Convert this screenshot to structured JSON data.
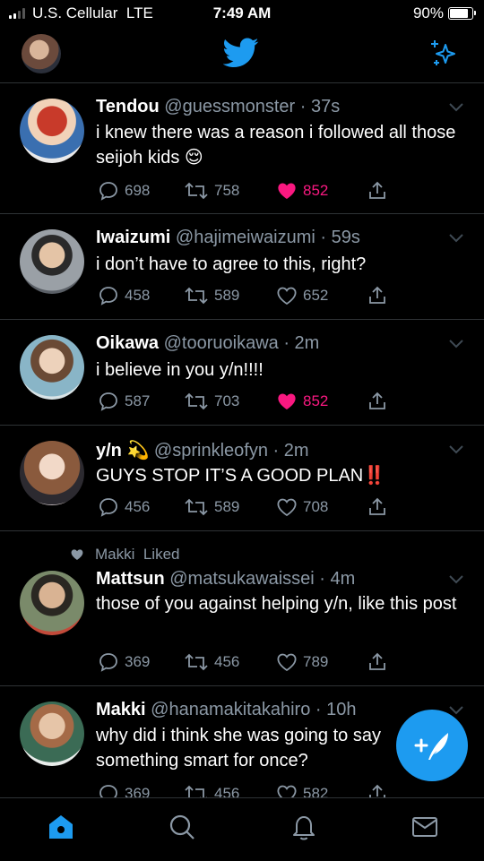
{
  "status_bar": {
    "carrier": "U.S. Cellular",
    "network": "LTE",
    "time": "7:49 AM",
    "battery": "90%"
  },
  "header": {
    "logo_icon": "twitter-bird-icon",
    "sparkle_icon": "sparkle-icon"
  },
  "tweets": [
    {
      "name": "Tendou",
      "handle": "@guessmonster",
      "time": "37s",
      "text": "i knew there was a reason i followed all those seijoh kids 😌",
      "replies": "698",
      "retweets": "758",
      "likes": "852",
      "liked": true
    },
    {
      "name": "Iwaizumi",
      "handle": "@hajimeiwaizumi",
      "time": "59s",
      "text": "i don’t have to agree to this, right?",
      "replies": "458",
      "retweets": "589",
      "likes": "652",
      "liked": false
    },
    {
      "name": "Oikawa",
      "handle": "@tooruoikawa",
      "time": "2m",
      "text": "i believe in you y/n!!!!",
      "replies": "587",
      "retweets": "703",
      "likes": "852",
      "liked": true
    },
    {
      "name": "y/n 💫",
      "handle": "@sprinkleofyn",
      "time": "2m",
      "text": "GUYS STOP IT’S A GOOD PLAN‼️",
      "replies": "456",
      "retweets": "589",
      "likes": "708",
      "liked": false
    },
    {
      "liked_by": "Makki  Liked",
      "name": "Mattsun",
      "handle": "@matsukawaissei",
      "time": "4m",
      "text": "those of you against helping y/n, like this post",
      "replies": "369",
      "retweets": "456",
      "likes": "789",
      "liked": false
    },
    {
      "name": "Makki",
      "handle": "@hanamakitakahiro",
      "time": "10h",
      "text": "why did i think she was going to say something smart for once?",
      "replies": "369",
      "retweets": "456",
      "likes": "582",
      "liked": false
    }
  ],
  "compose_button": {
    "icon": "compose-feather-icon"
  },
  "tab_bar": [
    {
      "name": "home",
      "icon": "home-icon",
      "active": true
    },
    {
      "name": "search",
      "icon": "search-icon",
      "active": false
    },
    {
      "name": "notifications",
      "icon": "bell-icon",
      "active": false
    },
    {
      "name": "messages",
      "icon": "mail-icon",
      "active": false
    }
  ],
  "colors": {
    "accent": "#1d9bf0",
    "like": "#f91880",
    "muted": "#8b98a5",
    "divider": "#2f3336"
  }
}
